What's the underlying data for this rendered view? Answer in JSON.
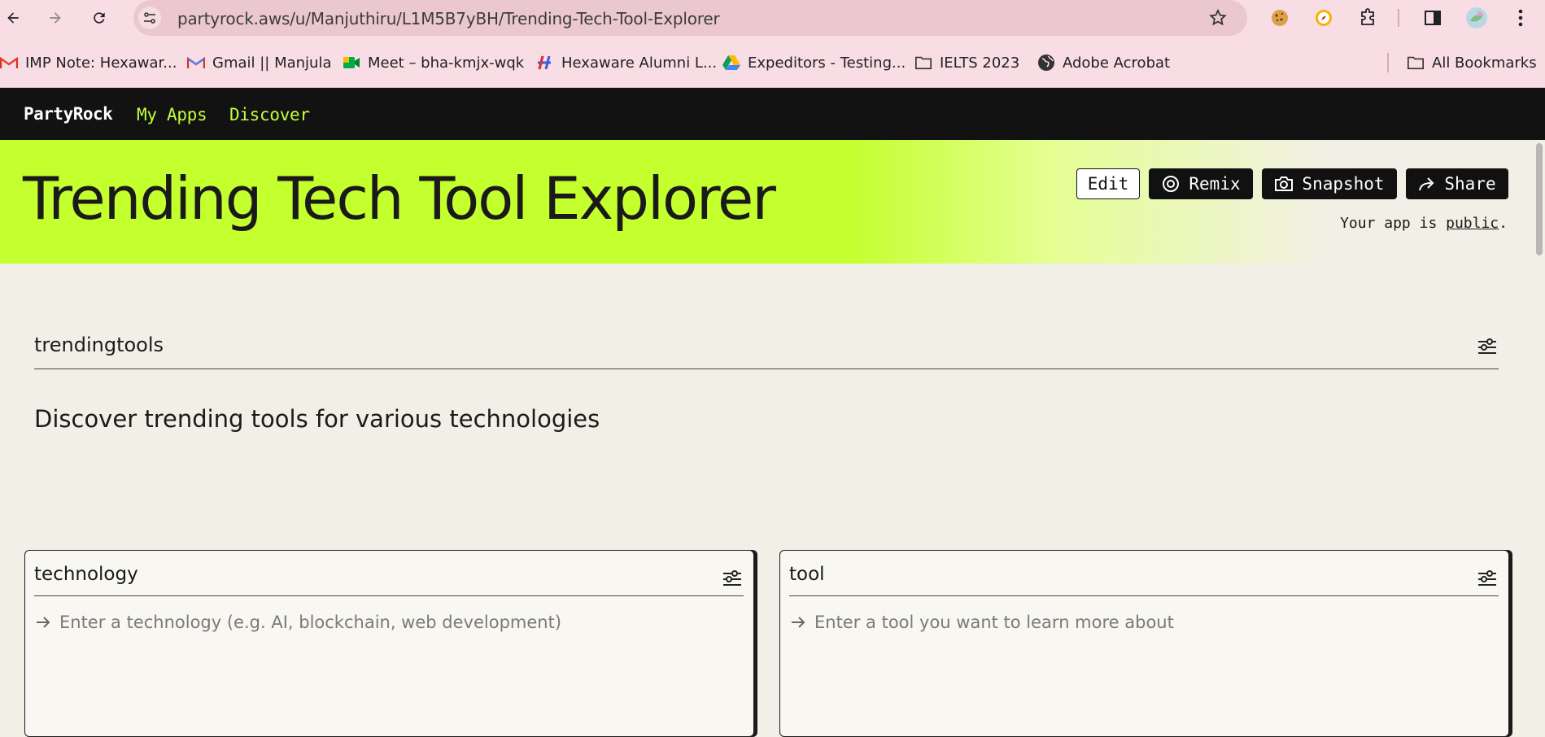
{
  "browser": {
    "url": "partyrock.aws/u/Manjuthiru/L1M5B7yBH/Trending-Tech-Tool-Explorer",
    "nav_icons": [
      "back-icon",
      "forward-icon",
      "reload-icon"
    ],
    "extension_icons": [
      "cookie-extension-icon",
      "compass-extension-icon",
      "extensions-puzzle-icon",
      "side-panel-icon",
      "profile-avatar-icon",
      "menu-kebab-icon"
    ]
  },
  "bookmarks": {
    "items": [
      {
        "label": "IMP Note: Hexawar...",
        "icon": "gmail-icon"
      },
      {
        "label": "Gmail || Manjula",
        "icon": "gmail-icon"
      },
      {
        "label": "Meet – bha-kmjx-wqk",
        "icon": "meet-icon"
      },
      {
        "label": "Hexaware Alumni L...",
        "icon": "hexaware-icon"
      },
      {
        "label": "Expeditors - Testing...",
        "icon": "drive-icon"
      },
      {
        "label": "IELTS 2023",
        "icon": "folder-icon"
      },
      {
        "label": "Adobe Acrobat",
        "icon": "globe-icon"
      }
    ],
    "all_bookmarks": "All Bookmarks"
  },
  "appnav": {
    "brand": "PartyRock",
    "links": [
      "My Apps",
      "Discover"
    ],
    "accent_color": "#c1ff3d"
  },
  "hero": {
    "title": "Trending Tech Tool Explorer",
    "buttons": {
      "edit": "Edit",
      "remix": "Remix",
      "snapshot": "Snapshot",
      "share": "Share"
    },
    "public_prefix": "Your app is ",
    "public_link": "public",
    "public_suffix": ".",
    "accent_color": "#c4ff2e"
  },
  "main": {
    "section_title": "trendingtools",
    "description": "Discover trending tools for various technologies",
    "cards": [
      {
        "title": "technology",
        "placeholder": "Enter a technology (e.g. AI, blockchain, web development)"
      },
      {
        "title": "tool",
        "placeholder": "Enter a tool you want to learn more about"
      }
    ]
  }
}
